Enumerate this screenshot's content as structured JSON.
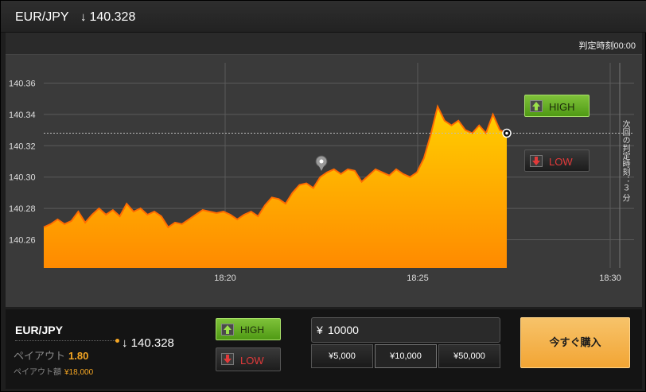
{
  "header": {
    "pair": "EUR/JPY",
    "arrow": "↓",
    "price": "140.328"
  },
  "chart_panel": {
    "judge_time": "判定時刻00:00",
    "next_judge": "次回の判定時刻：３ 分"
  },
  "chart_data": {
    "type": "area",
    "series_name": "",
    "x_ticks": [
      "18:20",
      "18:25",
      "18:30"
    ],
    "y_ticks": [
      "140.36",
      "140.34",
      "140.32",
      "140.30",
      "140.28",
      "140.26"
    ],
    "ylim": [
      140.242,
      140.378
    ],
    "current_price": 140.328,
    "line_color": "#ff6b00",
    "fill_top": "#ffd000",
    "fill_bottom": "#ff8a00",
    "points": [
      [
        0,
        140.268
      ],
      [
        1,
        140.27
      ],
      [
        2,
        140.273
      ],
      [
        3,
        140.27
      ],
      [
        4,
        140.272
      ],
      [
        5,
        140.278
      ],
      [
        6,
        140.271
      ],
      [
        7,
        140.276
      ],
      [
        8,
        140.28
      ],
      [
        9,
        140.276
      ],
      [
        10,
        140.279
      ],
      [
        11,
        140.275
      ],
      [
        12,
        140.283
      ],
      [
        13,
        140.278
      ],
      [
        14,
        140.28
      ],
      [
        15,
        140.276
      ],
      [
        16,
        140.278
      ],
      [
        17,
        140.275
      ],
      [
        18,
        140.268
      ],
      [
        19,
        140.271
      ],
      [
        20,
        140.27
      ],
      [
        21,
        140.273
      ],
      [
        22,
        140.276
      ],
      [
        23,
        140.279
      ],
      [
        24,
        140.278
      ],
      [
        25,
        140.277
      ],
      [
        26,
        140.278
      ],
      [
        27,
        140.276
      ],
      [
        28,
        140.273
      ],
      [
        29,
        140.276
      ],
      [
        30,
        140.278
      ],
      [
        31,
        140.275
      ],
      [
        32,
        140.282
      ],
      [
        33,
        140.287
      ],
      [
        34,
        140.286
      ],
      [
        35,
        140.283
      ],
      [
        36,
        140.29
      ],
      [
        37,
        140.295
      ],
      [
        38,
        140.296
      ],
      [
        39,
        140.293
      ],
      [
        40,
        140.3
      ],
      [
        41,
        140.303
      ],
      [
        42,
        140.305
      ],
      [
        43,
        140.302
      ],
      [
        44,
        140.305
      ],
      [
        45,
        140.304
      ],
      [
        46,
        140.297
      ],
      [
        47,
        140.301
      ],
      [
        48,
        140.305
      ],
      [
        49,
        140.303
      ],
      [
        50,
        140.301
      ],
      [
        51,
        140.305
      ],
      [
        52,
        140.302
      ],
      [
        53,
        140.3
      ],
      [
        54,
        140.303
      ],
      [
        55,
        140.312
      ],
      [
        56,
        140.327
      ],
      [
        57,
        140.345
      ],
      [
        58,
        140.336
      ],
      [
        59,
        140.333
      ],
      [
        60,
        140.336
      ],
      [
        61,
        140.33
      ],
      [
        62,
        140.328
      ],
      [
        63,
        140.333
      ],
      [
        64,
        140.328
      ],
      [
        65,
        140.34
      ],
      [
        66,
        140.33
      ],
      [
        67,
        140.328
      ]
    ]
  },
  "chart_side": {
    "high_label": "HIGH",
    "low_label": "LOW"
  },
  "order": {
    "pair": "EUR/JPY",
    "arrow": "↓",
    "price": "140.328",
    "payout_label": "ペイアウト",
    "payout_value": "1.80",
    "payout_amount_label": "ペイアウト額",
    "payout_amount_value": "¥18,000",
    "high_label": "HIGH",
    "low_label": "LOW",
    "currency": "¥",
    "amount": "10000",
    "presets": [
      "¥5,000",
      "¥10,000",
      "¥50,000"
    ],
    "buy_label": "今すぐ購入"
  }
}
